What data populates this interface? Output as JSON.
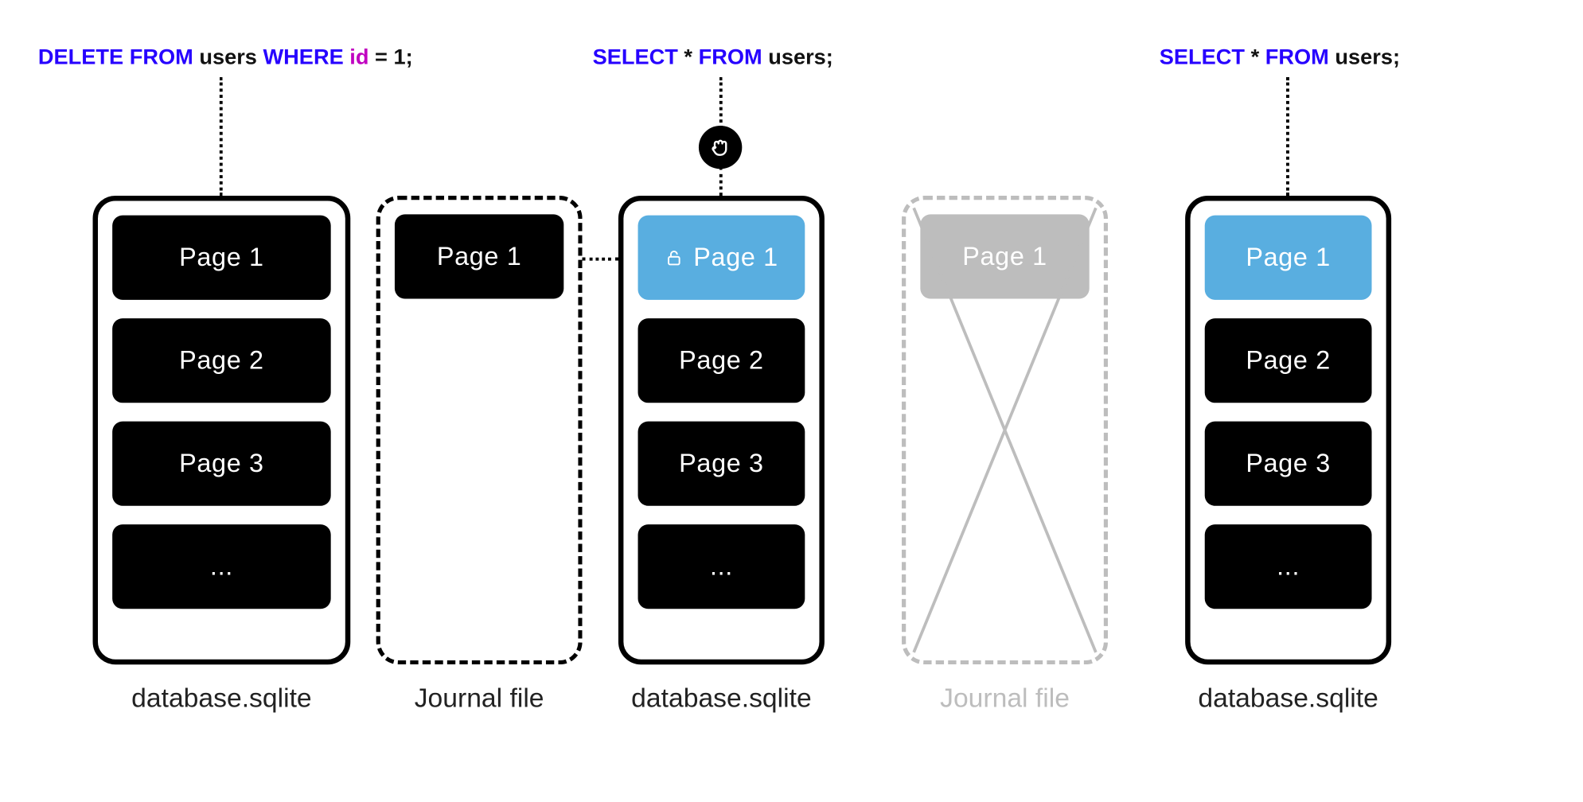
{
  "colors": {
    "keyword": "#2600ff",
    "identifier": "#c000c0",
    "page_blue": "#59aee0",
    "ghost": "#bdbdbd"
  },
  "queries": {
    "q1": {
      "kw_delete": "DELETE FROM",
      "tbl": "users",
      "kw_where": "WHERE",
      "col": "id",
      "eq": "=",
      "val": "1",
      "semi": ";"
    },
    "q2": {
      "kw_select": "SELECT",
      "star": "*",
      "kw_from": "FROM",
      "tbl": "users",
      "semi": ";"
    },
    "q3": {
      "kw_select": "SELECT",
      "star": "*",
      "kw_from": "FROM",
      "tbl": "users",
      "semi": ";"
    }
  },
  "pages": {
    "p1": "Page 1",
    "p2": "Page 2",
    "p3": "Page 3",
    "ell": "..."
  },
  "captions": {
    "db": "database.sqlite",
    "journal": "Journal file"
  }
}
